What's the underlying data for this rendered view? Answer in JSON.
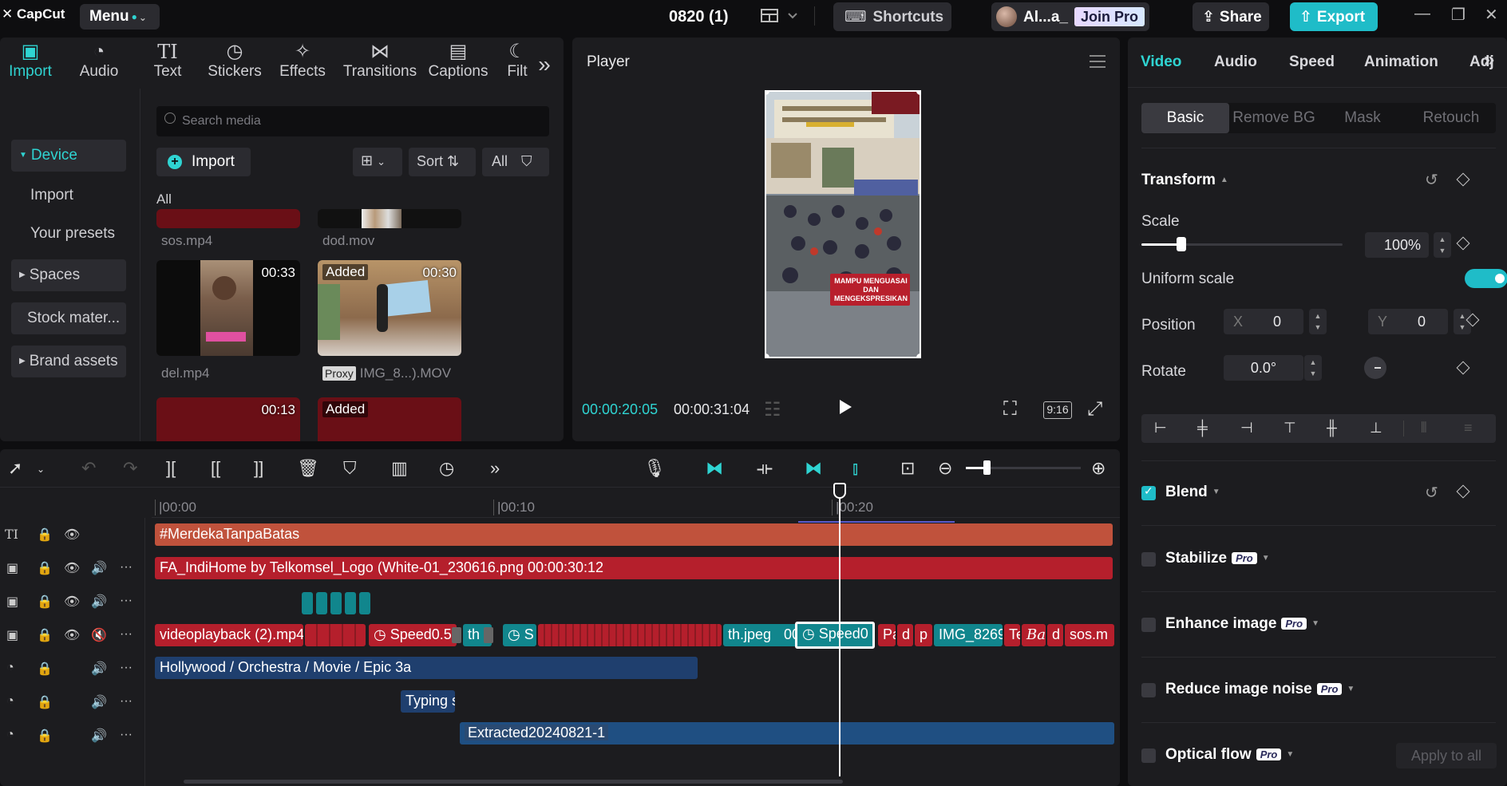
{
  "titlebar": {
    "logo": "CapCut",
    "menu_label": "Menu",
    "project_title": "0820 (1)",
    "shortcuts_label": "Shortcuts",
    "user_name": "Al...a_",
    "join_pro_label": "Join Pro",
    "share_label": "Share",
    "export_label": "Export"
  },
  "media_tabs": [
    {
      "label": "Import",
      "icon": "import-icon",
      "active": true
    },
    {
      "label": "Audio",
      "icon": "audio-icon"
    },
    {
      "label": "Text",
      "icon": "text-icon"
    },
    {
      "label": "Stickers",
      "icon": "stickers-icon"
    },
    {
      "label": "Effects",
      "icon": "effects-icon"
    },
    {
      "label": "Transitions",
      "icon": "transitions-icon"
    },
    {
      "label": "Captions",
      "icon": "captions-icon"
    },
    {
      "label": "Filt",
      "icon": "filters-icon"
    }
  ],
  "media_sidebar": {
    "device": "Device",
    "import": "Import",
    "your_presets": "Your presets",
    "spaces": "Spaces",
    "stock_materials": "Stock mater...",
    "brand_assets": "Brand assets"
  },
  "media": {
    "search_placeholder": "Search media",
    "import_label": "Import",
    "sort_label": "Sort",
    "filter_label": "All",
    "section_label": "All",
    "items": [
      {
        "name": "sos.mp4"
      },
      {
        "name": "dod.mov"
      },
      {
        "name": "del.mp4",
        "duration": "00:33"
      },
      {
        "name": "IMG_8...).MOV",
        "duration": "00:30",
        "badge": "Added",
        "proxy": "Proxy"
      },
      {
        "name": "",
        "duration": "00:13"
      },
      {
        "name": "",
        "badge": "Added"
      }
    ]
  },
  "player": {
    "title": "Player",
    "current_time": "00:00:20:05",
    "total_time": "00:00:31:04",
    "aspect_ratio": "9:16",
    "overlay_text": "MAMPU MENGUASAI DAN MENGEKSPRESIKAN"
  },
  "properties": {
    "tabs": [
      "Video",
      "Audio",
      "Speed",
      "Animation",
      "Adju"
    ],
    "active_tab": "Video",
    "subtabs": [
      "Basic",
      "Remove BG",
      "Mask",
      "Retouch"
    ],
    "active_subtab": "Basic",
    "transform_title": "Transform",
    "scale_label": "Scale",
    "scale_value": "100%",
    "scale_level": 0.2,
    "uniform_scale_label": "Uniform scale",
    "uniform_scale_on": true,
    "position_label": "Position",
    "pos_x_label": "X",
    "pos_x_value": "0",
    "pos_y_label": "Y",
    "pos_y_value": "0",
    "rotate_label": "Rotate",
    "rotate_value": "0.0°",
    "blend_label": "Blend",
    "stabilize_label": "Stabilize",
    "enhance_label": "Enhance image",
    "reduce_noise_label": "Reduce image noise",
    "optical_flow_label": "Optical flow",
    "pro_badge": "Pro",
    "apply_all_label": "Apply to all"
  },
  "timeline": {
    "ruler": [
      "|00:00",
      "|00:10",
      "|00:20"
    ],
    "zoom_level": 0.18,
    "tracks": [
      {
        "kind": "text",
        "clips": [
          "#MerdekaTanpaBatas"
        ]
      },
      {
        "kind": "video",
        "clips": [
          "FA_IndiHome by Telkomsel_Logo (White-01_230616.png  00:00:30:12"
        ]
      },
      {
        "kind": "video",
        "clips": []
      },
      {
        "kind": "main",
        "clips": [
          "videoplayback (2).mp4",
          "Speed0.5",
          "th",
          "S",
          "th.jpeg",
          "00",
          "Speed0",
          "Pa",
          "d",
          "p",
          "IMG_8269",
          "Te",
          "Ba",
          "d",
          "sos.m"
        ]
      },
      {
        "kind": "audio",
        "clips": [
          "Hollywood / Orchestra / Movie / Epic 3a"
        ]
      },
      {
        "kind": "audio",
        "clips": [
          "Typing s"
        ]
      },
      {
        "kind": "audio",
        "clips": [
          "Extracted20240821-1"
        ]
      }
    ]
  },
  "colors": {
    "accent": "#2fd4d2",
    "export_bg": "#1fbcc8",
    "text_clip": "#c0523c",
    "video_clip": "#b51f2c",
    "audio_clip": "#1f4f82"
  }
}
